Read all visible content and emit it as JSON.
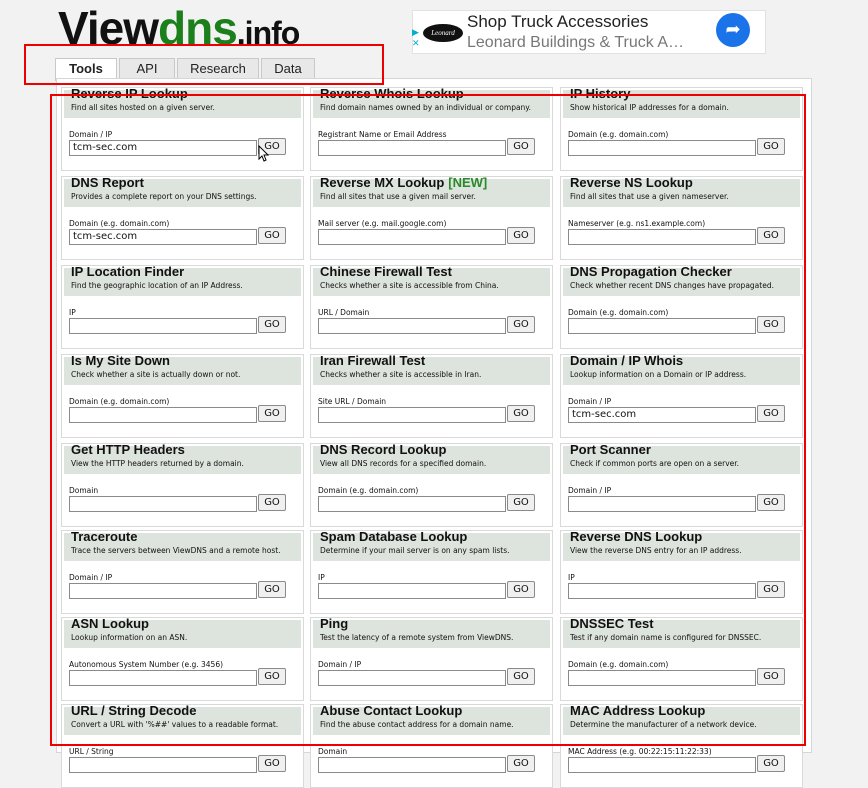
{
  "logo": {
    "part1": "View",
    "part2": "dns",
    "part3": ".info"
  },
  "ad": {
    "title": "Shop Truck Accessories",
    "subtitle": "Leonard Buildings & Truck A…",
    "logo_text": "Leonard"
  },
  "tabs": [
    {
      "label": "Tools",
      "active": true
    },
    {
      "label": "API",
      "active": false
    },
    {
      "label": "Research",
      "active": false
    },
    {
      "label": "Data",
      "active": false
    }
  ],
  "tools": [
    {
      "title": "Reverse IP Lookup",
      "desc": "Find all sites hosted on a given server.",
      "label": "Domain / IP",
      "value": "tcm-sec.com"
    },
    {
      "title": "Reverse Whois Lookup",
      "desc": "Find domain names owned by an individual or company.",
      "label": "Registrant Name or Email Address",
      "value": ""
    },
    {
      "title": "IP History",
      "desc": "Show historical IP addresses for a domain.",
      "label": "Domain (e.g. domain.com)",
      "value": ""
    },
    {
      "title": "DNS Report",
      "desc": "Provides a complete report on your DNS settings.",
      "label": "Domain (e.g. domain.com)",
      "value": "tcm-sec.com"
    },
    {
      "title": "Reverse MX Lookup",
      "badge": "[NEW]",
      "desc": "Find all sites that use a given mail server.",
      "label": "Mail server (e.g. mail.google.com)",
      "value": ""
    },
    {
      "title": "Reverse NS Lookup",
      "desc": "Find all sites that use a given nameserver.",
      "label": "Nameserver (e.g. ns1.example.com)",
      "value": ""
    },
    {
      "title": "IP Location Finder",
      "desc": "Find the geographic location of an IP Address.",
      "label": "IP",
      "value": ""
    },
    {
      "title": "Chinese Firewall Test",
      "desc": "Checks whether a site is accessible from China.",
      "label": "URL / Domain",
      "value": ""
    },
    {
      "title": "DNS Propagation Checker",
      "desc": "Check whether recent DNS changes have propagated.",
      "label": "Domain (e.g. domain.com)",
      "value": ""
    },
    {
      "title": "Is My Site Down",
      "desc": "Check whether a site is actually down or not.",
      "label": "Domain (e.g. domain.com)",
      "value": ""
    },
    {
      "title": "Iran Firewall Test",
      "desc": "Checks whether a site is accessible in Iran.",
      "label": "Site URL / Domain",
      "value": ""
    },
    {
      "title": "Domain / IP Whois",
      "desc": "Lookup information on a Domain or IP address.",
      "label": "Domain / IP",
      "value": "tcm-sec.com"
    },
    {
      "title": "Get HTTP Headers",
      "desc": "View the HTTP headers returned by a domain.",
      "label": "Domain",
      "value": ""
    },
    {
      "title": "DNS Record Lookup",
      "desc": "View all DNS records for a specified domain.",
      "label": "Domain (e.g. domain.com)",
      "value": ""
    },
    {
      "title": "Port Scanner",
      "desc": "Check if common ports are open on a server.",
      "label": "Domain / IP",
      "value": ""
    },
    {
      "title": "Traceroute",
      "desc": "Trace the servers between ViewDNS and a remote host.",
      "label": "Domain / IP",
      "value": ""
    },
    {
      "title": "Spam Database Lookup",
      "desc": "Determine if your mail server is on any spam lists.",
      "label": "IP",
      "value": ""
    },
    {
      "title": "Reverse DNS Lookup",
      "desc": "View the reverse DNS entry for an IP address.",
      "label": "IP",
      "value": ""
    },
    {
      "title": "ASN Lookup",
      "desc": "Lookup information on an ASN.",
      "label": "Autonomous System Number (e.g. 3456)",
      "value": ""
    },
    {
      "title": "Ping",
      "desc": "Test the latency of a remote system from ViewDNS.",
      "label": "Domain / IP",
      "value": ""
    },
    {
      "title": "DNSSEC Test",
      "desc": "Test if any domain name is configured for DNSSEC.",
      "label": "Domain (e.g. domain.com)",
      "value": ""
    },
    {
      "title": "URL / String Decode",
      "desc": "Convert a URL with '%##' values to a readable format.",
      "label": "URL / String",
      "value": ""
    },
    {
      "title": "Abuse Contact Lookup",
      "desc": "Find the abuse contact address for a domain name.",
      "label": "Domain",
      "value": ""
    },
    {
      "title": "MAC Address Lookup",
      "desc": "Determine the manufacturer of a network device.",
      "label": "MAC Address (e.g. 00:22:15:11:22:33)",
      "value": ""
    }
  ],
  "go_label": "GO",
  "colors": {
    "accent_green": "#1b7f1b",
    "header_bg": "#dde3dd",
    "highlight": "#ee0000"
  }
}
